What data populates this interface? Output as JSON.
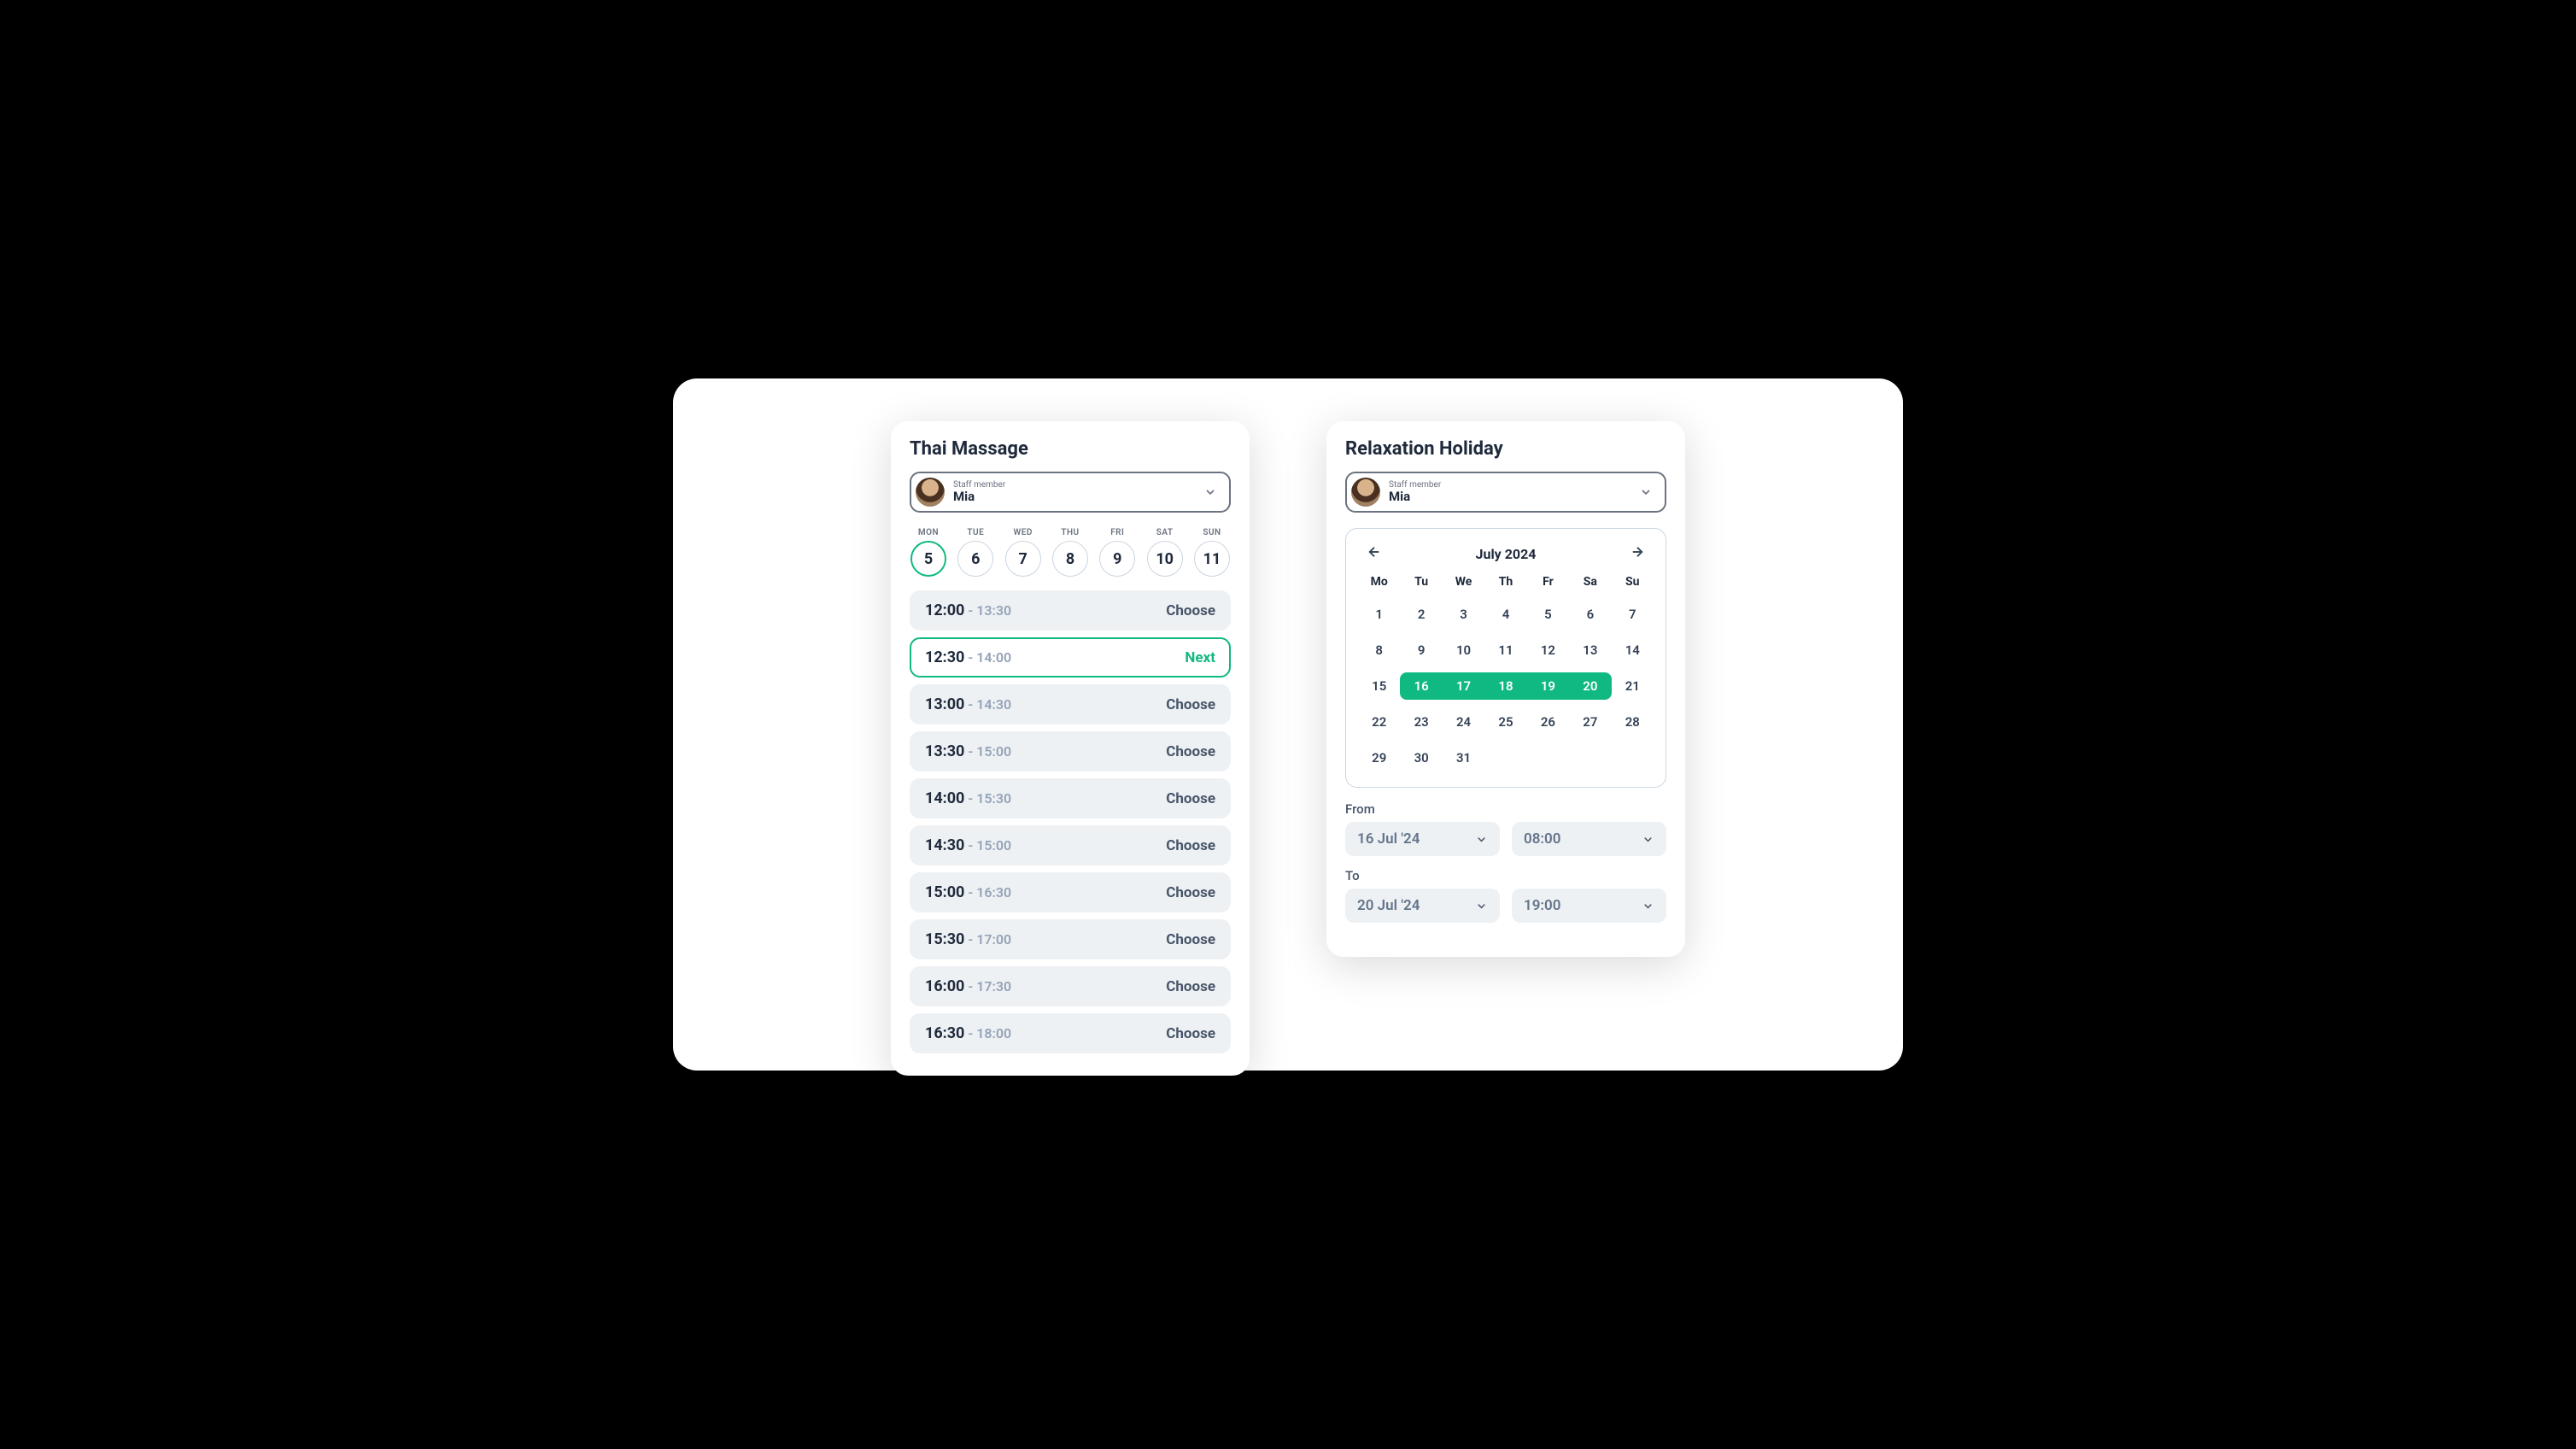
{
  "left": {
    "title": "Thai Massage",
    "staff_label": "Staff member",
    "staff_name": "Mia",
    "days": [
      {
        "abbr": "MON",
        "num": "5",
        "selected": true
      },
      {
        "abbr": "TUE",
        "num": "6"
      },
      {
        "abbr": "WED",
        "num": "7"
      },
      {
        "abbr": "THU",
        "num": "8"
      },
      {
        "abbr": "FRI",
        "num": "9"
      },
      {
        "abbr": "SAT",
        "num": "10"
      },
      {
        "abbr": "SUN",
        "num": "11"
      }
    ],
    "choose_label": "Choose",
    "next_label": "Next",
    "slots": [
      {
        "start": "12:00",
        "end": "13:30"
      },
      {
        "start": "12:30",
        "end": "14:00",
        "selected": true
      },
      {
        "start": "13:00",
        "end": "14:30"
      },
      {
        "start": "13:30",
        "end": "15:00"
      },
      {
        "start": "14:00",
        "end": "15:30"
      },
      {
        "start": "14:30",
        "end": "15:00"
      },
      {
        "start": "15:00",
        "end": "16:30"
      },
      {
        "start": "15:30",
        "end": "17:00"
      },
      {
        "start": "16:00",
        "end": "17:30"
      },
      {
        "start": "16:30",
        "end": "18:00"
      }
    ]
  },
  "right": {
    "title": "Relaxation Holiday",
    "staff_label": "Staff member",
    "staff_name": "Mia",
    "month_label": "July 2024",
    "dow": [
      "Mo",
      "Tu",
      "We",
      "Th",
      "Fr",
      "Sa",
      "Su"
    ],
    "range_start": 16,
    "range_end": 20,
    "weeks": [
      [
        1,
        2,
        3,
        4,
        5,
        6,
        7
      ],
      [
        8,
        9,
        10,
        11,
        12,
        13,
        14
      ],
      [
        15,
        16,
        17,
        18,
        19,
        20,
        21
      ],
      [
        22,
        23,
        24,
        25,
        26,
        27,
        28
      ],
      [
        29,
        30,
        31,
        null,
        null,
        null,
        null
      ]
    ],
    "from_label": "From",
    "to_label": "To",
    "from_date": "16 Jul '24",
    "from_time": "08:00",
    "to_date": "20 Jul '24",
    "to_time": "19:00"
  }
}
